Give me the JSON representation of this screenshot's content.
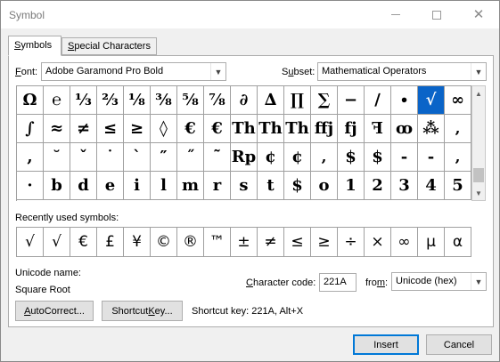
{
  "window": {
    "title": "Symbol"
  },
  "tabs": [
    {
      "pre": "",
      "key": "S",
      "post": "ymbols"
    },
    {
      "pre": "",
      "key": "S",
      "post": "pecial Characters"
    }
  ],
  "font": {
    "label_key": "F",
    "label_rest": "ont:",
    "value": "Adobe Garamond Pro Bold"
  },
  "subset": {
    "label_pre": "S",
    "label_key": "u",
    "label_rest": "bset:",
    "value": "Mathematical Operators"
  },
  "symbols": [
    [
      "Ω",
      "℮",
      "⅓",
      "⅔",
      "⅛",
      "⅜",
      "⅝",
      "⅞",
      "∂",
      "∆",
      "∏",
      "∑",
      "−",
      "∕",
      "∙",
      "√",
      "∞"
    ],
    [
      "∫",
      "≈",
      "≠",
      "≤",
      "≥",
      "◊",
      "€",
      "€",
      "Th",
      "Th",
      "Th",
      "ffj",
      "fj",
      "ꟻ",
      "ꝏ",
      "⁂",
      "‚"
    ],
    [
      ",",
      "˘",
      "ˇ",
      "˙",
      "ˋ",
      "″",
      "˝",
      "˜",
      "Rp",
      "¢",
      "¢",
      "‚",
      "$",
      "$",
      "-",
      "-",
      "‚"
    ],
    [
      "·",
      "b",
      "d",
      "e",
      "i",
      "l",
      "m",
      "r",
      "s",
      "t",
      "$",
      "o",
      "1",
      "2",
      "3",
      "4",
      "5"
    ]
  ],
  "selected_symbol": "√",
  "recent": {
    "label": "Recently used symbols:",
    "items": [
      "√",
      "√",
      "€",
      "£",
      "¥",
      "©",
      "®",
      "™",
      "±",
      "≠",
      "≤",
      "≥",
      "÷",
      "×",
      "∞",
      "µ",
      "α"
    ]
  },
  "unicode": {
    "label": "Unicode name:",
    "value": "Square Root"
  },
  "char_code": {
    "label_pre": "",
    "label_key": "C",
    "label_rest": "haracter code:",
    "value": "221A"
  },
  "from": {
    "label_pre": "fro",
    "label_key": "m",
    "label_rest": ":",
    "value": "Unicode (hex)"
  },
  "buttons": {
    "autocorrect": {
      "key": "A",
      "rest": "utoCorrect..."
    },
    "shortcut_key": {
      "pre": "Shortcut ",
      "key": "K",
      "rest": "ey..."
    },
    "insert": "Insert",
    "cancel": "Cancel"
  },
  "shortcut_text": "Shortcut key: 221A, Alt+X",
  "colors": {
    "selection": "#0a64c8",
    "accent": "#0078d7"
  }
}
